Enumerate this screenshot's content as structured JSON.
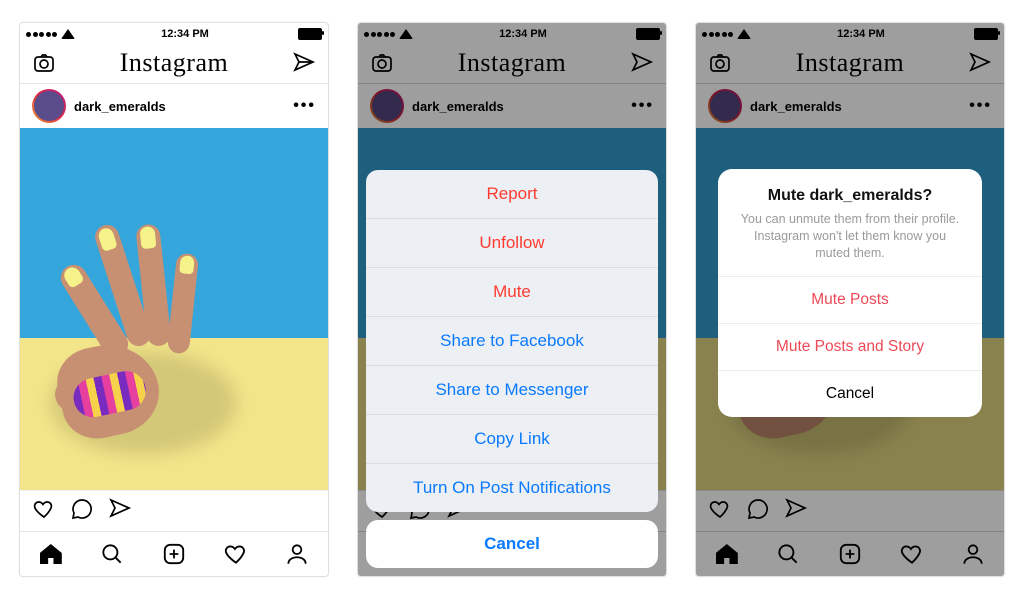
{
  "status": {
    "time": "12:34 PM"
  },
  "header": {
    "app_name": "Instagram"
  },
  "post": {
    "username": "dark_emeralds"
  },
  "sheet": {
    "items": [
      {
        "label": "Report",
        "style": "red"
      },
      {
        "label": "Unfollow",
        "style": "red"
      },
      {
        "label": "Mute",
        "style": "red"
      },
      {
        "label": "Share to Facebook",
        "style": "blue"
      },
      {
        "label": "Share to Messenger",
        "style": "blue"
      },
      {
        "label": "Copy Link",
        "style": "blue"
      },
      {
        "label": "Turn On Post Notifications",
        "style": "blue"
      }
    ],
    "cancel": "Cancel"
  },
  "alert": {
    "title": "Mute dark_emeralds?",
    "body": "You can unmute them from their profile. Instagram won't let them know you muted them.",
    "buttons": [
      {
        "label": "Mute Posts",
        "style": "pink"
      },
      {
        "label": "Mute Posts and Story",
        "style": "pink"
      },
      {
        "label": "Cancel",
        "style": "black"
      }
    ]
  },
  "colors": {
    "accent_blue": "#0a7aff",
    "accent_red": "#ff3b30",
    "accent_pink": "#ed4956"
  }
}
